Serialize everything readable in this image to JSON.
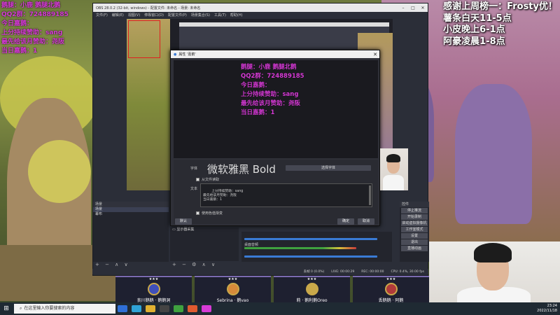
{
  "overlay_left": [
    "鹅腿：小鹿 鹅腿北鹅",
    "QQ2群：724889185",
    "今日嘉鹅：",
    "上分持续赞助：sang",
    "最先给该月赞助：尧阪",
    "当日嘉鹅：1"
  ],
  "overlay_right": [
    "感谢上周榜一：Frosty优！",
    "薯条白天11-5点",
    "小皮晚上6-1点",
    "阿豪凌晨1-8点"
  ],
  "obs": {
    "title": "OBS 28.0.2 (32-bit, windows) - 配置文件: 未命名 - 场景: 未命名",
    "menu": [
      "文件(F)",
      "编辑(E)",
      "视图(V)",
      "停靠窗口(D)",
      "配置文件(P)",
      "场景集合(S)",
      "工具(T)",
      "帮助(H)"
    ],
    "scenes_header": "场景",
    "scenes": [
      "场景",
      "幕布"
    ],
    "sources_header": "来源",
    "sources": [
      "显示器采集"
    ],
    "controls_header": "控件",
    "controls": [
      "停止推流",
      "开始录制",
      "启动虚拟摄像机",
      "工作室模式",
      "设置",
      "退出",
      "直播动画"
    ],
    "mixer_label": "桌面音频",
    "status": {
      "dropped": "丢帧 0 (0.0%)",
      "live": "LIVE: 00:00:29",
      "rec": "REC: 00:00:00",
      "cpu": "CPU: 0.4%, 30.00 fps"
    }
  },
  "dialog": {
    "title": "属性 '嘉鹅'",
    "preview_lines": [
      "鹅腿：小鹿 鹅腿北鹅",
      "QQ2群：724889185",
      "今日嘉鹅：",
      "上分持续赞助：sang",
      "最先给该月赞助：尧阪",
      "当日嘉鹅：1"
    ],
    "font_label": "字体",
    "font_name": "微软雅黑 Bold",
    "select_font_btn": "选择字体",
    "from_file_label": "从文件读取",
    "text_label": "文本",
    "text_value": "上分持续赞助：sang\n最先给该月赞助：尧阪\n当日嘉鹅：1",
    "vertical_label": "使用色值渐变",
    "defaults_btn": "默认",
    "ok_btn": "确定",
    "cancel_btn": "取消"
  },
  "heroes": [
    {
      "stars": "★★★",
      "name": "丧川鹅鹅 · 鹅鹅洞",
      "color": "#3f4fb8"
    },
    {
      "stars": "★★★",
      "name": "Sebrina · 鹅vao",
      "color": "#d68a3a"
    },
    {
      "stars": "★★★",
      "name": "莉 · 鹅利鹅Oreo",
      "color": "#c9a84a"
    },
    {
      "stars": "★★★",
      "name": "丢鹅鹅 · 阿鹅",
      "color": "#b03a3a"
    }
  ],
  "taskbar": {
    "search_placeholder": "在这里输入你要搜索的内容",
    "time": "23:24",
    "date": "2022/11/18"
  }
}
